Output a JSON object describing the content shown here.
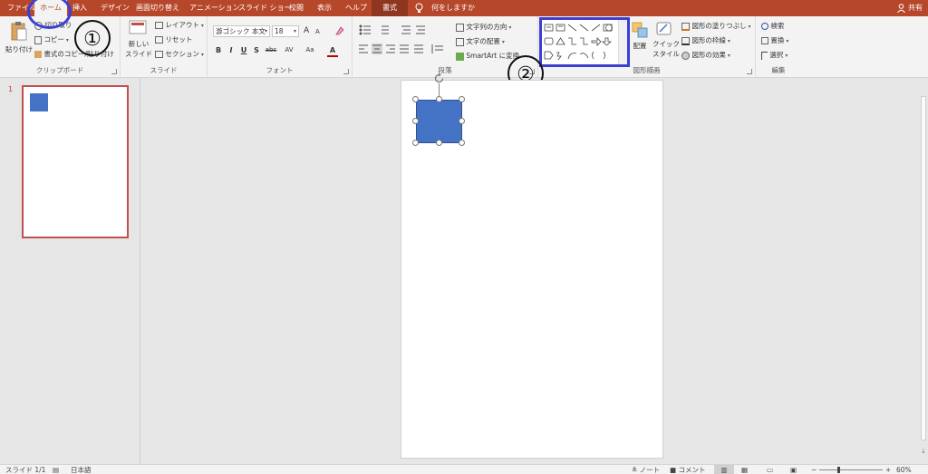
{
  "tabs": {
    "file": "ファイル",
    "home": "ホーム",
    "insert": "挿入",
    "design": "デザイン",
    "transitions": "画面切り替え",
    "animations": "アニメーション",
    "slideshow": "スライド ショー",
    "review": "校閲",
    "view": "表示",
    "help": "ヘルプ",
    "format": "書式"
  },
  "tell_me": "何をしますか",
  "share": "共有",
  "clipboard": {
    "label": "クリップボード",
    "paste": "貼り付け",
    "cut": "切り取り",
    "copy": "コピー",
    "format_painter": "書式のコピー/貼り付け"
  },
  "slides": {
    "label": "スライド",
    "new_slide_1": "新しい",
    "new_slide_2": "スライド",
    "layout": "レイアウト",
    "reset": "リセット",
    "section": "セクション"
  },
  "font": {
    "label": "フォント",
    "name": "游ゴシック 本文",
    "size": "18",
    "bold": "B",
    "italic": "I",
    "underline": "U",
    "shadow": "S",
    "strike": "abc",
    "spacing": "AV",
    "case": "Aa",
    "color": "A",
    "grow": "A",
    "shrink": "A"
  },
  "paragraph": {
    "label": "段落",
    "text_direction": "文字列の方向",
    "align_text": "文字の配置",
    "smartart": "SmartArt に変換"
  },
  "drawing": {
    "label": "図形描画",
    "arrange": "配置",
    "quick_styles_1": "クイック",
    "quick_styles_2": "スタイル",
    "shape_fill": "図形の塗りつぶし",
    "shape_outline": "図形の枠線",
    "shape_effects": "図形の効果"
  },
  "editing": {
    "label": "編集",
    "find": "検索",
    "replace": "置換",
    "select": "選択"
  },
  "annotations": {
    "marker_1": "①",
    "marker_2": "②"
  },
  "thumbnails": {
    "slide_number": "1"
  },
  "status": {
    "slide_info": "スライド 1/1",
    "language": "日本語",
    "notes": "ノート",
    "comments": "コメント",
    "zoom": "60%",
    "zoom_minus": "−",
    "zoom_plus": "+"
  },
  "colors": {
    "accent": "#b7472a",
    "highlight": "#3c3fd6",
    "shape_fill": "#4472c4"
  }
}
